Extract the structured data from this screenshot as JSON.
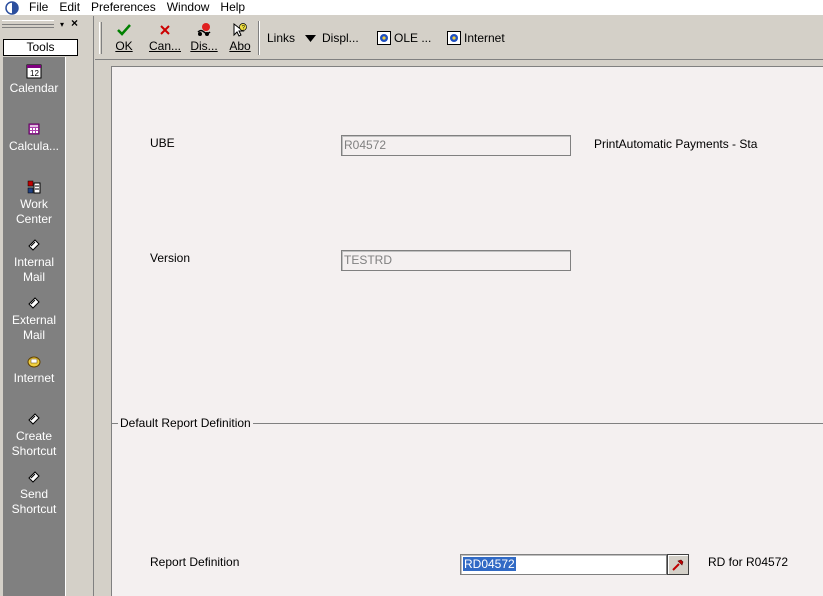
{
  "menu": {
    "items": [
      "File",
      "Edit",
      "Preferences",
      "Window",
      "Help"
    ]
  },
  "tools": {
    "header": "Tools",
    "dropdown_glyph": "▾",
    "close_glyph": "×",
    "items": [
      {
        "label": "Calendar",
        "icon": "calendar-icon"
      },
      {
        "label": "Calcula...",
        "icon": "calculator-icon"
      },
      {
        "label": "Work Center",
        "icon": "work-center-icon"
      },
      {
        "label": "Internal Mail",
        "icon": "internal-mail-icon"
      },
      {
        "label": "External Mail",
        "icon": "external-mail-icon"
      },
      {
        "label": "Internet",
        "icon": "internet-icon"
      },
      {
        "label": "Create Shortcut",
        "icon": "create-shortcut-icon"
      },
      {
        "label": "Send Shortcut",
        "icon": "send-shortcut-icon"
      }
    ]
  },
  "toolbar": {
    "ok_label": "OK",
    "cancel_label": "Can...",
    "display_label": "Dis...",
    "about_label": "Abo",
    "links_label": "Links",
    "displ_label": "Displ...",
    "ole_label": "OLE ...",
    "internet_label": "Internet"
  },
  "form": {
    "ube_label": "UBE",
    "ube_value": "R04572",
    "ube_description": "PrintAutomatic Payments - Sta",
    "version_label": "Version",
    "version_value": "TESTRD",
    "group_title": "Default Report Definition",
    "report_def_label": "Report Definition",
    "report_def_value": "RD04572",
    "report_def_description": "RD for R04572"
  },
  "colors": {
    "window_bg": "#d4d0c8",
    "form_bg": "#f4f0f0",
    "tools_list_bg": "#808080",
    "selection": "#316ac5",
    "ok_check": "#008000",
    "cancel_x": "#cc0000"
  }
}
